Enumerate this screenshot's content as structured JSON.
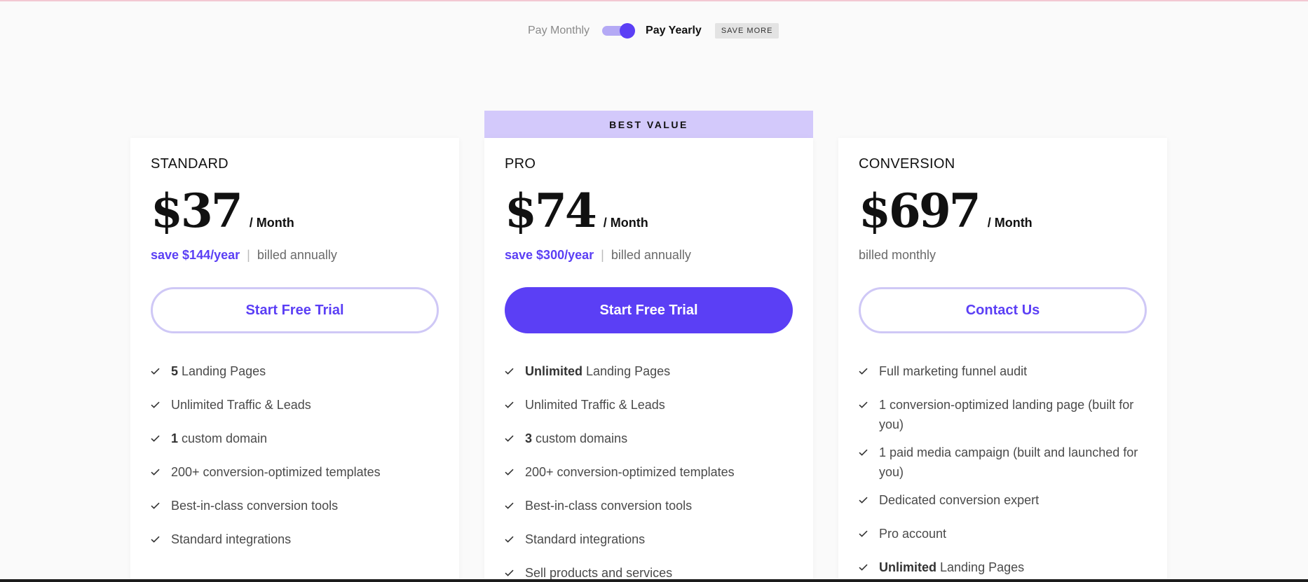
{
  "billing": {
    "monthly_label": "Pay Monthly",
    "yearly_label": "Pay Yearly",
    "save_badge": "SAVE MORE",
    "selected": "yearly"
  },
  "colors": {
    "accent": "#5b3ff5",
    "accent_light": "#d3c9fb",
    "outline": "#cfc8f6",
    "background": "#fafafa"
  },
  "best_value_label": "BEST VALUE",
  "plans": [
    {
      "name": "STANDARD",
      "price": "$37",
      "period": "/ Month",
      "savings": "save $144/year",
      "separator": "|",
      "billing": "billed annually",
      "cta": "Start Free Trial",
      "features": [
        {
          "bold": "5",
          "text": " Landing Pages"
        },
        {
          "bold": "",
          "text": "Unlimited Traffic & Leads"
        },
        {
          "bold": "1",
          "text": " custom domain"
        },
        {
          "bold": "",
          "text": "200+ conversion-optimized templates"
        },
        {
          "bold": "",
          "text": "Best-in-class conversion tools"
        },
        {
          "bold": "",
          "text": "Standard integrations"
        }
      ]
    },
    {
      "name": "PRO",
      "price": "$74",
      "period": "/ Month",
      "savings": "save $300/year",
      "separator": "|",
      "billing": "billed annually",
      "cta": "Start Free Trial",
      "features": [
        {
          "bold": "Unlimited",
          "text": " Landing Pages"
        },
        {
          "bold": "",
          "text": "Unlimited Traffic & Leads"
        },
        {
          "bold": "3",
          "text": " custom domains"
        },
        {
          "bold": "",
          "text": "200+ conversion-optimized templates"
        },
        {
          "bold": "",
          "text": "Best-in-class conversion tools"
        },
        {
          "bold": "",
          "text": "Standard integrations"
        },
        {
          "bold": "",
          "text": "Sell products and services"
        }
      ]
    },
    {
      "name": "CONVERSION",
      "price": "$697",
      "period": "/ Month",
      "billing": "billed monthly",
      "cta": "Contact Us",
      "features": [
        {
          "bold": "",
          "text": "Full marketing funnel audit"
        },
        {
          "bold": "",
          "text": "1 conversion-optimized landing page (built for you)"
        },
        {
          "bold": "",
          "text": "1 paid media campaign (built and launched for you)"
        },
        {
          "bold": "",
          "text": "Dedicated conversion expert"
        },
        {
          "bold": "",
          "text": "Pro account"
        },
        {
          "bold": "Unlimited",
          "text": " Landing Pages"
        }
      ]
    }
  ]
}
